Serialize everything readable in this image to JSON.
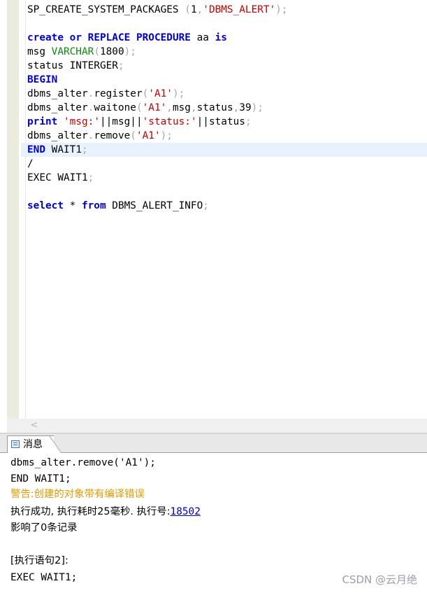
{
  "editor": {
    "line1": {
      "fn": "SP_CREATE_SYSTEM_PACKAGES",
      "p1": " (",
      "num": "1",
      "comma": ",",
      "str": "'DBMS_ALERT'",
      "p2": ");"
    },
    "line2": {
      "k1": "create",
      "sp1": " ",
      "k2": "or",
      "sp2": " ",
      "k3": "REPLACE",
      "sp3": " ",
      "k4": "PROCEDURE",
      "name": " aa ",
      "k5": "is"
    },
    "line3": {
      "a": "msg ",
      "type": "VARCHAR",
      "p1": "(",
      "num": "1800",
      "p2": ");"
    },
    "line4": {
      "a": "status INTERGER",
      "p": ";"
    },
    "line5": {
      "k": "BEGIN"
    },
    "line6": {
      "a": "dbms_alter",
      "d": ".",
      "b": "register",
      "p1": "(",
      "s": "'A1'",
      "p2": ");"
    },
    "line7": {
      "a": "dbms_alter",
      "d": ".",
      "b": "waitone",
      "p1": "(",
      "s": "'A1'",
      "c1": ",",
      "x1": "msg",
      "c2": ",",
      "x2": "status",
      "c3": ",",
      "n": "39",
      "p2": ");"
    },
    "line8": {
      "k": "print",
      "sp": " ",
      "s1": "'msg:'",
      "o1": "||msg||",
      "s2": "'status:'",
      "o2": "||status",
      "p": ";"
    },
    "line9": {
      "a": "dbms_alter",
      "d": ".",
      "b": "remove",
      "p1": "(",
      "s": "'A1'",
      "p2": ");"
    },
    "line10": {
      "k": "END",
      "a": " WAIT1",
      "p": ";"
    },
    "line11": {
      "a": "/"
    },
    "line12": {
      "a": "EXEC WAIT1",
      "p": ";"
    },
    "line13": {
      "k1": "select",
      "a": " * ",
      "k2": "from",
      "b": " DBMS_ALERT_INFO",
      "p": ";"
    }
  },
  "scrollbar": {
    "left_arrow": "<"
  },
  "tab": {
    "label": "消息"
  },
  "messages": {
    "m1": "dbms_alter.remove('A1');",
    "m2": "END WAIT1;",
    "m3": "警告:创建的对象带有编译错误",
    "m4_pre": "执行成功, 执行耗时25毫秒. 执行号:",
    "m4_link": "18502",
    "m5": "影响了0条记录",
    "m6": "[执行语句2]:",
    "m7": "EXEC WAIT1;"
  },
  "watermark": "CSDN @云月绝",
  "colors": {
    "keyword": "#0000d0",
    "type": "#0a8a0a",
    "string": "#c80000",
    "punct": "#a7a7a7",
    "warning": "#e39b00",
    "link": "#0000c0",
    "active_line": "#e8f2fe"
  }
}
